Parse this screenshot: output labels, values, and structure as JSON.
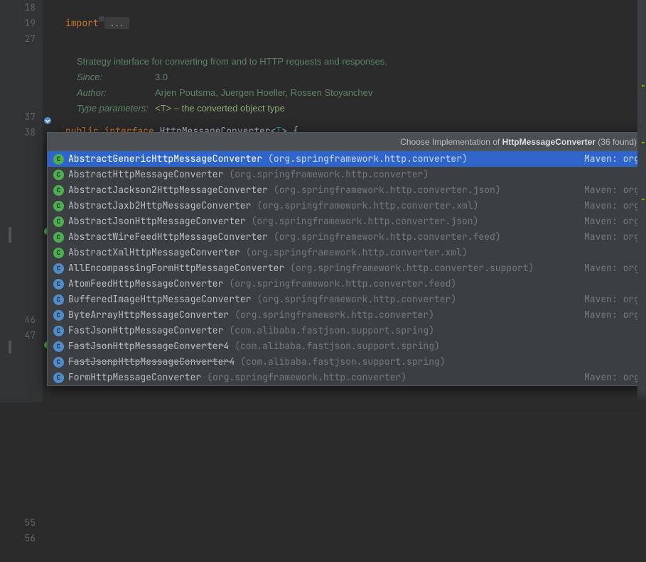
{
  "gutter": {
    "lines": [
      "18",
      "19",
      "27",
      "",
      "",
      "",
      "",
      "37",
      "38",
      "",
      "",
      "",
      "",
      "",
      "",
      "",
      "",
      "",
      "",
      "",
      "46",
      "47",
      "",
      "",
      "",
      "",
      "",
      "",
      "",
      "",
      "",
      "",
      "",
      "55",
      "56",
      ""
    ]
  },
  "code": {
    "import_kw": "import",
    "fold": "...",
    "javadoc": {
      "desc": "Strategy interface for converting from and to HTTP requests and responses.",
      "since_label": "Since:",
      "since": "3.0",
      "author_label": "Author:",
      "author": "Arjen Poutsma, Juergen Hoeller, Rossen Stoyanchev",
      "typeparam_label": "Type parameters:",
      "typeparam": "<T> – the converted object type"
    },
    "public_kw": "public",
    "interface_kw": "interface",
    "cls": "HttpMessageConverter",
    "tp": "T",
    "brace": " {"
  },
  "popup": {
    "title_prefix": "Choose Implementation of ",
    "title_target": "HttpMessageConverter",
    "count": " (36 found)",
    "items": [
      {
        "icon": "C",
        "ic": "green",
        "name": "AbstractGenericHttpMessageConverter",
        "pkg": "(org.springframework.http.converter)",
        "right": "Maven: org",
        "sel": true,
        "dep": false
      },
      {
        "icon": "C",
        "ic": "green",
        "name": "AbstractHttpMessageConverter",
        "pkg": "(org.springframework.http.converter)",
        "right": "",
        "sel": false,
        "dep": false
      },
      {
        "icon": "C",
        "ic": "green",
        "name": "AbstractJackson2HttpMessageConverter",
        "pkg": "(org.springframework.http.converter.json)",
        "right": "Maven: org",
        "sel": false,
        "dep": false
      },
      {
        "icon": "C",
        "ic": "green",
        "name": "AbstractJaxb2HttpMessageConverter",
        "pkg": "(org.springframework.http.converter.xml)",
        "right": "Maven: org",
        "sel": false,
        "dep": false
      },
      {
        "icon": "C",
        "ic": "green",
        "name": "AbstractJsonHttpMessageConverter",
        "pkg": "(org.springframework.http.converter.json)",
        "right": "Maven: org",
        "sel": false,
        "dep": false
      },
      {
        "icon": "C",
        "ic": "green",
        "name": "AbstractWireFeedHttpMessageConverter",
        "pkg": "(org.springframework.http.converter.feed)",
        "right": "Maven: org",
        "sel": false,
        "dep": false
      },
      {
        "icon": "C",
        "ic": "green",
        "name": "AbstractXmlHttpMessageConverter",
        "pkg": "(org.springframework.http.converter.xml)",
        "right": "",
        "sel": false,
        "dep": false
      },
      {
        "icon": "C",
        "ic": "blue",
        "name": "AllEncompassingFormHttpMessageConverter",
        "pkg": "(org.springframework.http.converter.support)",
        "right": "Maven: org",
        "sel": false,
        "dep": false
      },
      {
        "icon": "C",
        "ic": "blue",
        "name": "AtomFeedHttpMessageConverter",
        "pkg": "(org.springframework.http.converter.feed)",
        "right": "",
        "sel": false,
        "dep": false
      },
      {
        "icon": "C",
        "ic": "blue",
        "name": "BufferedImageHttpMessageConverter",
        "pkg": "(org.springframework.http.converter)",
        "right": "Maven: org",
        "sel": false,
        "dep": false
      },
      {
        "icon": "C",
        "ic": "blue",
        "name": "ByteArrayHttpMessageConverter",
        "pkg": "(org.springframework.http.converter)",
        "right": "Maven: org",
        "sel": false,
        "dep": false
      },
      {
        "icon": "C",
        "ic": "blue",
        "name": "FastJsonHttpMessageConverter",
        "pkg": "(com.alibaba.fastjson.support.spring)",
        "right": "",
        "sel": false,
        "dep": false
      },
      {
        "icon": "C",
        "ic": "blue",
        "name": "FastJsonHttpMessageConverter4",
        "pkg": "(com.alibaba.fastjson.support.spring)",
        "right": "",
        "sel": false,
        "dep": true
      },
      {
        "icon": "C",
        "ic": "blue",
        "name": "FastJsonpHttpMessageConverter4",
        "pkg": "(com.alibaba.fastjson.support.spring)",
        "right": "",
        "sel": false,
        "dep": true
      },
      {
        "icon": "C",
        "ic": "blue",
        "name": "FormHttpMessageConverter",
        "pkg": "(org.springframework.http.converter)",
        "right": "Maven: org",
        "sel": false,
        "dep": false
      }
    ]
  }
}
